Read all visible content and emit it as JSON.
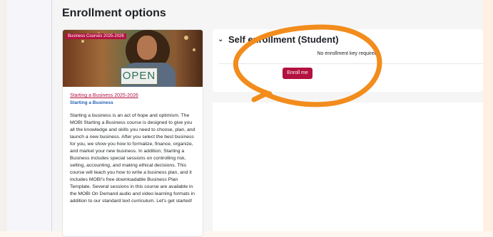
{
  "page": {
    "heading": "Enrollment options"
  },
  "course": {
    "badge": "Business Courses 2025-2026",
    "sign_text": "OPEN",
    "title": "Starting a Business 2025-2026",
    "category": "Starting a Business",
    "description": "Starting a business is an act of hope and optimism. The MOBI Starting a Business course is designed to give you all the knowledge and skills you need to choose, plan, and launch a new business. After you select the best business for you, we show you how to formalize, finance, organize, and market your new business. In addition, Starting a Business includes special sessions on controlling risk, selling, accounting, and making ethical decisions. This course will teach you how to write a business plan, and it includes MOBI's free downloadable Business Plan Template. Several sessions in this course are available in the MOBI On Demand audio and video learning formats in addition to our standard text curriculum. Let's get started!"
  },
  "enrollment": {
    "title": "Self enrollment (Student)",
    "message": "No enrollment key required.",
    "button_label": "Enroll me"
  },
  "colors": {
    "brand": "#b3113f",
    "annotation": "#f28c1c",
    "category_link": "#2461b5"
  },
  "icons": {
    "section_toggle": "chevron-down-icon"
  }
}
